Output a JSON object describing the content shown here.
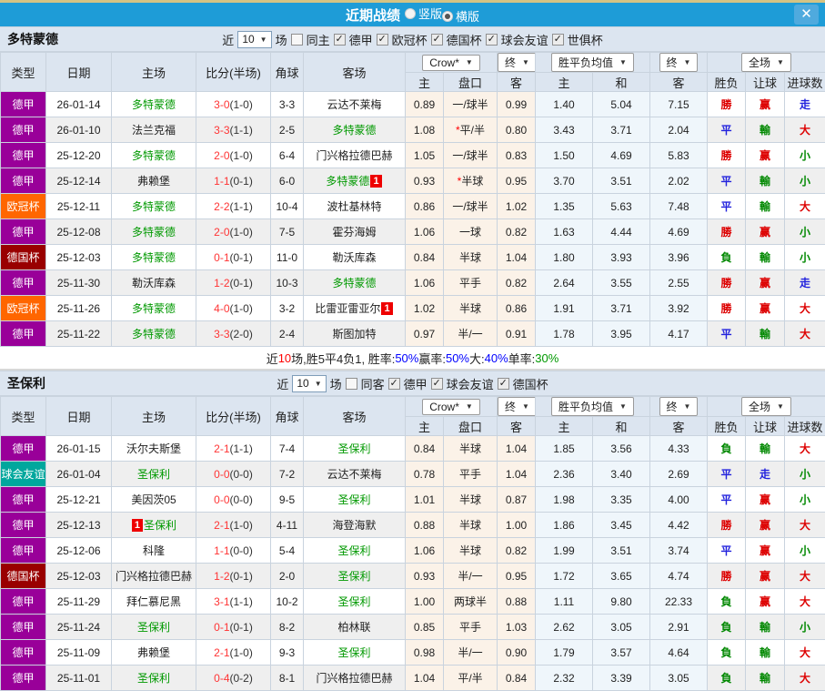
{
  "icons": {
    "close": "✕",
    "dropdown_arrow": "▼",
    "check": "✓"
  },
  "titlebar": {
    "title": "近期战绩",
    "radios": [
      {
        "label": "竖版",
        "checked": false
      },
      {
        "label": "横版",
        "checked": true
      }
    ]
  },
  "table_header": {
    "type": "类型",
    "date": "日期",
    "home": "主场",
    "score": "比分(半场)",
    "corner": "角球",
    "away": "客场",
    "odds_home": "主",
    "odds_line": "盘口",
    "odds_away": "客",
    "avg_home": "主",
    "avg_draw": "和",
    "avg_away": "客",
    "result_wl": "胜负",
    "result_handicap": "让球",
    "result_goals": "进球数",
    "dd_provider": "Crow*",
    "dd_final1": "终",
    "dd_avg": "胜平负均值",
    "dd_final2": "终",
    "dd_scope": "全场"
  },
  "filters_common": {
    "near": "近",
    "games": "场"
  },
  "type_colors": {
    "德甲": "#990099",
    "欧冠杯": "#ff6600",
    "德国杯": "#990000",
    "球会友谊": "#00a79d"
  },
  "result_colors": {
    "勝": "#dd0000",
    "負": "#008800",
    "平": "#2222dd",
    "赢": "#dd0000",
    "輸": "#008800",
    "走": "#2222dd",
    "大": "#dd0000",
    "小": "#008800"
  },
  "sections": [
    {
      "team": "多特蒙德",
      "filters": {
        "count": "10",
        "same_side": {
          "label": "同主",
          "checked": false
        },
        "leagues": [
          {
            "label": "德甲",
            "checked": true
          },
          {
            "label": "欧冠杯",
            "checked": true
          },
          {
            "label": "德国杯",
            "checked": true
          },
          {
            "label": "球会友谊",
            "checked": true
          },
          {
            "label": "世俱杯",
            "checked": true
          }
        ]
      },
      "rows": [
        {
          "type": "德甲",
          "date": "26-01-14",
          "home": "多特蒙德",
          "home_focus": true,
          "home_badge": "",
          "home_badge_pos": "after",
          "score": "3-0",
          "half": "(1-0)",
          "corner": "3-3",
          "away": "云达不莱梅",
          "away_focus": false,
          "away_badge": "",
          "odds": [
            "0.89",
            "一/球半",
            "0.99"
          ],
          "line_star": false,
          "avg": [
            "1.40",
            "5.04",
            "7.15"
          ],
          "results": [
            "勝",
            "赢",
            "走"
          ]
        },
        {
          "type": "德甲",
          "date": "26-01-10",
          "home": "法兰克福",
          "home_focus": false,
          "home_badge": "",
          "home_badge_pos": "after",
          "score": "3-3",
          "half": "(1-1)",
          "corner": "2-5",
          "away": "多特蒙德",
          "away_focus": true,
          "away_badge": "",
          "odds": [
            "1.08",
            "平/半",
            "0.80"
          ],
          "line_star": true,
          "avg": [
            "3.43",
            "3.71",
            "2.04"
          ],
          "results": [
            "平",
            "輸",
            "大"
          ]
        },
        {
          "type": "德甲",
          "date": "25-12-20",
          "home": "多特蒙德",
          "home_focus": true,
          "home_badge": "",
          "home_badge_pos": "after",
          "score": "2-0",
          "half": "(1-0)",
          "corner": "6-4",
          "away": "门兴格拉德巴赫",
          "away_focus": false,
          "away_badge": "",
          "odds": [
            "1.05",
            "一/球半",
            "0.83"
          ],
          "line_star": false,
          "avg": [
            "1.50",
            "4.69",
            "5.83"
          ],
          "results": [
            "勝",
            "赢",
            "小"
          ]
        },
        {
          "type": "德甲",
          "date": "25-12-14",
          "home": "弗赖堡",
          "home_focus": false,
          "home_badge": "",
          "home_badge_pos": "after",
          "score": "1-1",
          "half": "(0-1)",
          "corner": "6-0",
          "away": "多特蒙德",
          "away_focus": true,
          "away_badge": "1",
          "odds": [
            "0.93",
            "半球",
            "0.95"
          ],
          "line_star": true,
          "avg": [
            "3.70",
            "3.51",
            "2.02"
          ],
          "results": [
            "平",
            "輸",
            "小"
          ]
        },
        {
          "type": "欧冠杯",
          "date": "25-12-11",
          "home": "多特蒙德",
          "home_focus": true,
          "home_badge": "",
          "home_badge_pos": "after",
          "score": "2-2",
          "half": "(1-1)",
          "corner": "10-4",
          "away": "波杜基林特",
          "away_focus": false,
          "away_badge": "",
          "odds": [
            "0.86",
            "一/球半",
            "1.02"
          ],
          "line_star": false,
          "avg": [
            "1.35",
            "5.63",
            "7.48"
          ],
          "results": [
            "平",
            "輸",
            "大"
          ]
        },
        {
          "type": "德甲",
          "date": "25-12-08",
          "home": "多特蒙德",
          "home_focus": true,
          "home_badge": "",
          "home_badge_pos": "after",
          "score": "2-0",
          "half": "(1-0)",
          "corner": "7-5",
          "away": "霍芬海姆",
          "away_focus": false,
          "away_badge": "",
          "odds": [
            "1.06",
            "一球",
            "0.82"
          ],
          "line_star": false,
          "avg": [
            "1.63",
            "4.44",
            "4.69"
          ],
          "results": [
            "勝",
            "赢",
            "小"
          ]
        },
        {
          "type": "德国杯",
          "date": "25-12-03",
          "home": "多特蒙德",
          "home_focus": true,
          "home_badge": "",
          "home_badge_pos": "after",
          "score": "0-1",
          "half": "(0-1)",
          "corner": "11-0",
          "away": "勒沃库森",
          "away_focus": false,
          "away_badge": "",
          "odds": [
            "0.84",
            "半球",
            "1.04"
          ],
          "line_star": false,
          "avg": [
            "1.80",
            "3.93",
            "3.96"
          ],
          "results": [
            "負",
            "輸",
            "小"
          ]
        },
        {
          "type": "德甲",
          "date": "25-11-30",
          "home": "勒沃库森",
          "home_focus": false,
          "home_badge": "",
          "home_badge_pos": "after",
          "score": "1-2",
          "half": "(0-1)",
          "corner": "10-3",
          "away": "多特蒙德",
          "away_focus": true,
          "away_badge": "",
          "odds": [
            "1.06",
            "平手",
            "0.82"
          ],
          "line_star": false,
          "avg": [
            "2.64",
            "3.55",
            "2.55"
          ],
          "results": [
            "勝",
            "赢",
            "走"
          ]
        },
        {
          "type": "欧冠杯",
          "date": "25-11-26",
          "home": "多特蒙德",
          "home_focus": true,
          "home_badge": "",
          "home_badge_pos": "after",
          "score": "4-0",
          "half": "(1-0)",
          "corner": "3-2",
          "away": "比雷亚雷亚尔",
          "away_focus": false,
          "away_badge": "1",
          "odds": [
            "1.02",
            "半球",
            "0.86"
          ],
          "line_star": false,
          "avg": [
            "1.91",
            "3.71",
            "3.92"
          ],
          "results": [
            "勝",
            "赢",
            "大"
          ]
        },
        {
          "type": "德甲",
          "date": "25-11-22",
          "home": "多特蒙德",
          "home_focus": true,
          "home_badge": "",
          "home_badge_pos": "after",
          "score": "3-3",
          "half": "(2-0)",
          "corner": "2-4",
          "away": "斯图加特",
          "away_focus": false,
          "away_badge": "",
          "odds": [
            "0.97",
            "半/一",
            "0.91"
          ],
          "line_star": false,
          "avg": [
            "1.78",
            "3.95",
            "4.17"
          ],
          "results": [
            "平",
            "輸",
            "大"
          ]
        }
      ],
      "summary": [
        {
          "text": "近",
          "color": "#222222"
        },
        {
          "text": "10",
          "color": "#ff0000"
        },
        {
          "text": "场,胜5平4负1, 胜率:",
          "color": "#222222"
        },
        {
          "text": "50%",
          "color": "#0000ff"
        },
        {
          "text": " 赢率:",
          "color": "#222222"
        },
        {
          "text": "50%",
          "color": "#0000ff"
        },
        {
          "text": " 大:",
          "color": "#222222"
        },
        {
          "text": "40%",
          "color": "#0000ff"
        },
        {
          "text": " 单率:",
          "color": "#222222"
        },
        {
          "text": "30%",
          "color": "#009900"
        }
      ]
    },
    {
      "team": "圣保利",
      "filters": {
        "count": "10",
        "same_side": {
          "label": "同客",
          "checked": false
        },
        "leagues": [
          {
            "label": "德甲",
            "checked": true
          },
          {
            "label": "球会友谊",
            "checked": true
          },
          {
            "label": "德国杯",
            "checked": true
          }
        ]
      },
      "rows": [
        {
          "type": "德甲",
          "date": "26-01-15",
          "home": "沃尔夫斯堡",
          "home_focus": false,
          "home_badge": "",
          "home_badge_pos": "after",
          "score": "2-1",
          "half": "(1-1)",
          "corner": "7-4",
          "away": "圣保利",
          "away_focus": true,
          "away_badge": "",
          "odds": [
            "0.84",
            "半球",
            "1.04"
          ],
          "line_star": false,
          "avg": [
            "1.85",
            "3.56",
            "4.33"
          ],
          "results": [
            "負",
            "輸",
            "大"
          ]
        },
        {
          "type": "球会友谊",
          "date": "26-01-04",
          "home": "圣保利",
          "home_focus": true,
          "home_badge": "",
          "home_badge_pos": "after",
          "score": "0-0",
          "half": "(0-0)",
          "corner": "7-2",
          "away": "云达不莱梅",
          "away_focus": false,
          "away_badge": "",
          "odds": [
            "0.78",
            "平手",
            "1.04"
          ],
          "line_star": false,
          "avg": [
            "2.36",
            "3.40",
            "2.69"
          ],
          "results": [
            "平",
            "走",
            "小"
          ]
        },
        {
          "type": "德甲",
          "date": "25-12-21",
          "home": "美因茨05",
          "home_focus": false,
          "home_badge": "",
          "home_badge_pos": "after",
          "score": "0-0",
          "half": "(0-0)",
          "corner": "9-5",
          "away": "圣保利",
          "away_focus": true,
          "away_badge": "",
          "odds": [
            "1.01",
            "半球",
            "0.87"
          ],
          "line_star": false,
          "avg": [
            "1.98",
            "3.35",
            "4.00"
          ],
          "results": [
            "平",
            "赢",
            "小"
          ]
        },
        {
          "type": "德甲",
          "date": "25-12-13",
          "home": "圣保利",
          "home_focus": true,
          "home_badge": "1",
          "home_badge_pos": "before",
          "score": "2-1",
          "half": "(1-0)",
          "corner": "4-11",
          "away": "海登海默",
          "away_focus": false,
          "away_badge": "",
          "odds": [
            "0.88",
            "半球",
            "1.00"
          ],
          "line_star": false,
          "avg": [
            "1.86",
            "3.45",
            "4.42"
          ],
          "results": [
            "勝",
            "赢",
            "大"
          ]
        },
        {
          "type": "德甲",
          "date": "25-12-06",
          "home": "科隆",
          "home_focus": false,
          "home_badge": "",
          "home_badge_pos": "after",
          "score": "1-1",
          "half": "(0-0)",
          "corner": "5-4",
          "away": "圣保利",
          "away_focus": true,
          "away_badge": "",
          "odds": [
            "1.06",
            "半球",
            "0.82"
          ],
          "line_star": false,
          "avg": [
            "1.99",
            "3.51",
            "3.74"
          ],
          "results": [
            "平",
            "赢",
            "小"
          ]
        },
        {
          "type": "德国杯",
          "date": "25-12-03",
          "home": "门兴格拉德巴赫",
          "home_focus": false,
          "home_badge": "",
          "home_badge_pos": "after",
          "score": "1-2",
          "half": "(0-1)",
          "corner": "2-0",
          "away": "圣保利",
          "away_focus": true,
          "away_badge": "",
          "odds": [
            "0.93",
            "半/一",
            "0.95"
          ],
          "line_star": false,
          "avg": [
            "1.72",
            "3.65",
            "4.74"
          ],
          "results": [
            "勝",
            "赢",
            "大"
          ]
        },
        {
          "type": "德甲",
          "date": "25-11-29",
          "home": "拜仁慕尼黑",
          "home_focus": false,
          "home_badge": "",
          "home_badge_pos": "after",
          "score": "3-1",
          "half": "(1-1)",
          "corner": "10-2",
          "away": "圣保利",
          "away_focus": true,
          "away_badge": "",
          "odds": [
            "1.00",
            "两球半",
            "0.88"
          ],
          "line_star": false,
          "avg": [
            "1.11",
            "9.80",
            "22.33"
          ],
          "results": [
            "負",
            "赢",
            "大"
          ]
        },
        {
          "type": "德甲",
          "date": "25-11-24",
          "home": "圣保利",
          "home_focus": true,
          "home_badge": "",
          "home_badge_pos": "after",
          "score": "0-1",
          "half": "(0-1)",
          "corner": "8-2",
          "away": "柏林联",
          "away_focus": false,
          "away_badge": "",
          "odds": [
            "0.85",
            "平手",
            "1.03"
          ],
          "line_star": false,
          "avg": [
            "2.62",
            "3.05",
            "2.91"
          ],
          "results": [
            "負",
            "輸",
            "小"
          ]
        },
        {
          "type": "德甲",
          "date": "25-11-09",
          "home": "弗赖堡",
          "home_focus": false,
          "home_badge": "",
          "home_badge_pos": "after",
          "score": "2-1",
          "half": "(1-0)",
          "corner": "9-3",
          "away": "圣保利",
          "away_focus": true,
          "away_badge": "",
          "odds": [
            "0.98",
            "半/一",
            "0.90"
          ],
          "line_star": false,
          "avg": [
            "1.79",
            "3.57",
            "4.64"
          ],
          "results": [
            "負",
            "輸",
            "大"
          ]
        },
        {
          "type": "德甲",
          "date": "25-11-01",
          "home": "圣保利",
          "home_focus": true,
          "home_badge": "",
          "home_badge_pos": "after",
          "score": "0-4",
          "half": "(0-2)",
          "corner": "8-1",
          "away": "门兴格拉德巴赫",
          "away_focus": false,
          "away_badge": "",
          "odds": [
            "1.04",
            "平/半",
            "0.84"
          ],
          "line_star": false,
          "avg": [
            "2.32",
            "3.39",
            "3.05"
          ],
          "results": [
            "負",
            "輸",
            "大"
          ]
        }
      ],
      "summary": null
    }
  ]
}
